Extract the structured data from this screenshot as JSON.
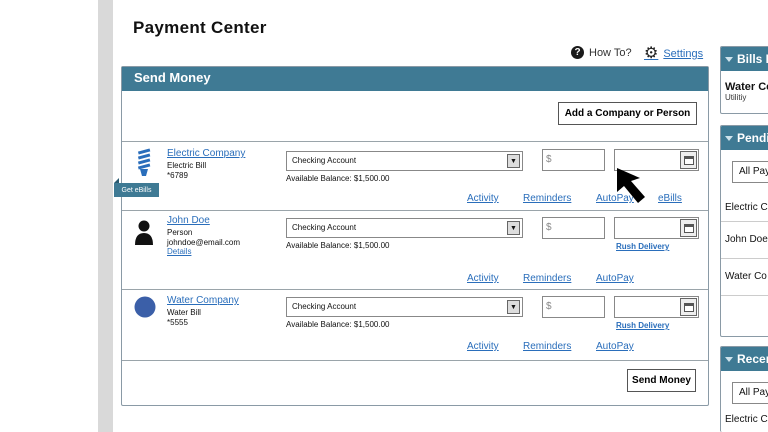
{
  "page": {
    "title": "Payment Center"
  },
  "topbar": {
    "how_to": "How To?",
    "settings": "Settings"
  },
  "send_money": {
    "header": "Send Money",
    "add_button": "Add a Company or Person",
    "send_button": "Send Money",
    "ebills_tag": "Get eBills",
    "payees": [
      {
        "name": "Electric Company",
        "type": "Electric Bill",
        "account": "*6789",
        "account_select": "Checking Account",
        "balance": "Available Balance: $1,500.00",
        "amount_placeholder": "$",
        "actions": [
          "Activity",
          "Reminders",
          "AutoPay",
          "eBills"
        ]
      },
      {
        "name": "John Doe",
        "type": "Person",
        "email": "johndoe@email.com",
        "details": "Details",
        "account_select": "Checking Account",
        "balance": "Available Balance: $1,500.00",
        "amount_placeholder": "$",
        "rush": "Rush Delivery",
        "actions": [
          "Activity",
          "Reminders",
          "AutoPay"
        ]
      },
      {
        "name": "Water Company",
        "type": "Water Bill",
        "account": "*5555",
        "account_select": "Checking Account",
        "balance": "Available Balance: $1,500.00",
        "amount_placeholder": "$",
        "rush": "Rush Delivery",
        "actions": [
          "Activity",
          "Reminders",
          "AutoPay"
        ]
      }
    ]
  },
  "sidebar": {
    "bills_due": {
      "header": "Bills D",
      "item_name": "Water Co",
      "item_sub": "Utilitiy"
    },
    "pending": {
      "header": "Pendi",
      "filter": "All Pay",
      "items": [
        "Electric C",
        "John Doe",
        "Water Co"
      ]
    },
    "recent": {
      "header": "Recen",
      "filter": "All Pay",
      "items": [
        "Electric C"
      ]
    }
  },
  "colors": {
    "header_bg": "#3f7a94",
    "link": "#2a6ebb"
  }
}
